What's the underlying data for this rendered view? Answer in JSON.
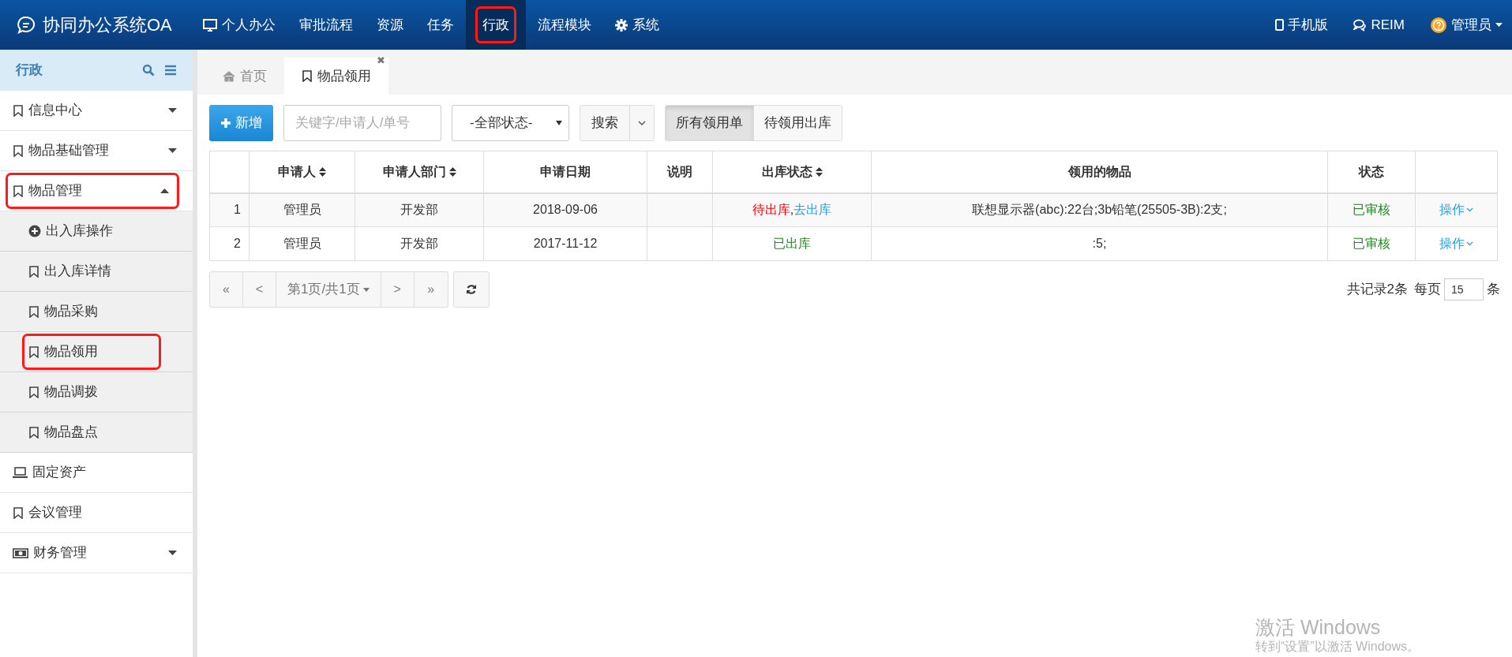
{
  "app": {
    "title": "协同办公系统OA"
  },
  "top_nav": [
    {
      "label": "个人办公",
      "kind": "monitor",
      "selected": false,
      "highlighted": false
    },
    {
      "label": "审批流程",
      "kind": "plain",
      "selected": false,
      "highlighted": false
    },
    {
      "label": "资源",
      "kind": "plain",
      "selected": false,
      "highlighted": false
    },
    {
      "label": "任务",
      "kind": "plain",
      "selected": false,
      "highlighted": false
    },
    {
      "label": "行政",
      "kind": "plain",
      "selected": true,
      "highlighted": true
    },
    {
      "label": "流程模块",
      "kind": "plain",
      "selected": false,
      "highlighted": false
    },
    {
      "label": "系统",
      "kind": "gear",
      "selected": false,
      "highlighted": false
    }
  ],
  "top_right": [
    {
      "label": "手机版",
      "kind": "phone"
    },
    {
      "label": "REIM",
      "kind": "chat"
    },
    {
      "label": "管理员",
      "kind": "user"
    }
  ],
  "sidebar": {
    "title": "行政",
    "items": [
      {
        "label": "信息中心",
        "kind": "bookmark",
        "expanded": false,
        "highlighted": false
      },
      {
        "label": "物品基础管理",
        "kind": "bookmark",
        "expanded": false,
        "highlighted": false
      },
      {
        "label": "物品管理",
        "kind": "bookmark",
        "expanded": true,
        "highlighted": true,
        "children": [
          {
            "label": "出入库操作",
            "kind": "add",
            "highlighted": false
          },
          {
            "label": "出入库详情",
            "kind": "bookmark",
            "highlighted": false
          },
          {
            "label": "物品采购",
            "kind": "bookmark",
            "highlighted": false
          },
          {
            "label": "物品领用",
            "kind": "bookmark",
            "highlighted": true
          },
          {
            "label": "物品调拨",
            "kind": "bookmark",
            "highlighted": false
          },
          {
            "label": "物品盘点",
            "kind": "bookmark",
            "highlighted": false
          }
        ]
      },
      {
        "label": "固定资产",
        "kind": "laptop",
        "highlighted": false
      },
      {
        "label": "会议管理",
        "kind": "bookmark",
        "highlighted": false
      },
      {
        "label": "财务管理",
        "kind": "cash",
        "expanded": false,
        "highlighted": false
      }
    ]
  },
  "tabs": [
    {
      "label": "首页",
      "kind": "home",
      "selected": false
    },
    {
      "label": "物品领用",
      "kind": "bookmark",
      "selected": true,
      "close": "✖"
    }
  ],
  "toolbar": {
    "add_button": "新增",
    "search_field": {
      "placeholder": "关键字/申请人/单号"
    },
    "status_select": "-全部状态-",
    "search_button": "搜索",
    "filters": [
      {
        "label": "所有领用单",
        "selected": true
      },
      {
        "label": "待领用出库",
        "selected": false
      }
    ]
  },
  "table": {
    "columns": [
      {
        "sortable": false
      },
      {
        "label": "申请人",
        "sortable": true
      },
      {
        "label": "申请人部门",
        "sortable": true
      },
      {
        "label": "申请日期",
        "sortable": false
      },
      {
        "label": "说明",
        "sortable": false
      },
      {
        "label": "出库状态",
        "sortable": true
      },
      {
        "label": "领用的物品",
        "sortable": false
      },
      {
        "label": "状态",
        "sortable": false
      },
      {
        "sortable": false
      }
    ],
    "rows": [
      {
        "index": "1",
        "applicant": "管理员",
        "department": "开发部",
        "date": "2018-09-06",
        "stock_status": [
          {
            "text": "待出库",
            "kind": "pending"
          },
          {
            "text": ",",
            "kind": "plain"
          },
          {
            "text": "去出库",
            "kind": "link"
          }
        ],
        "items": "联想显示器(abc):22台;3b铅笔(25505-3B):2支;",
        "status": "已审核",
        "action": "操作"
      },
      {
        "index": "2",
        "applicant": "管理员",
        "department": "开发部",
        "date": "2017-11-12",
        "stock_status": [
          {
            "text": "已出库",
            "kind": "done"
          }
        ],
        "items": ":5;",
        "status": "已审核",
        "action": "操作"
      }
    ]
  },
  "pagination": {
    "first": "«",
    "prev": "<",
    "page": "第1页/共1页",
    "next": ">",
    "last": "»",
    "total": "共记录2条",
    "per_page_label": "每页",
    "per_page": "15",
    "per_page_unit": "条"
  },
  "os_notice": {
    "title": "激活 Windows",
    "subtitle": "转到“设置”以激活 Windows。"
  }
}
